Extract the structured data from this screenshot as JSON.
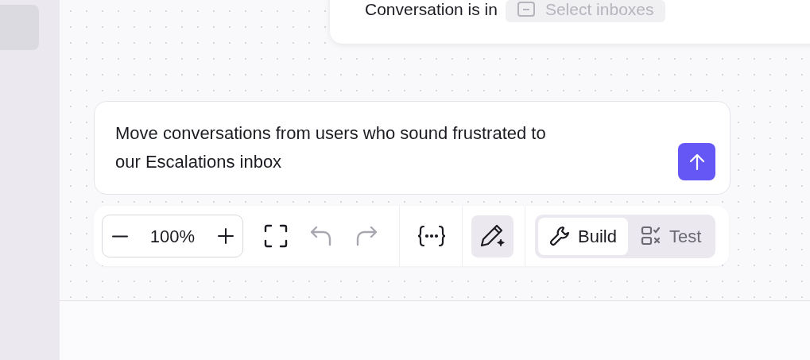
{
  "condition_card": {
    "label": "Conversation is in",
    "select": {
      "placeholder": "Select inboxes"
    }
  },
  "prompt": {
    "value": "Move conversations from users who sound frustrated to our Escalations inbox"
  },
  "toolbar": {
    "zoom": "100%",
    "undo": {
      "disabled": true
    },
    "redo": {
      "disabled": true
    },
    "edit_mode": {
      "selected": true
    },
    "modes": [
      {
        "label": "Build",
        "kind": "build",
        "selected": true
      },
      {
        "label": "Test",
        "kind": "test",
        "selected": false
      }
    ]
  }
}
